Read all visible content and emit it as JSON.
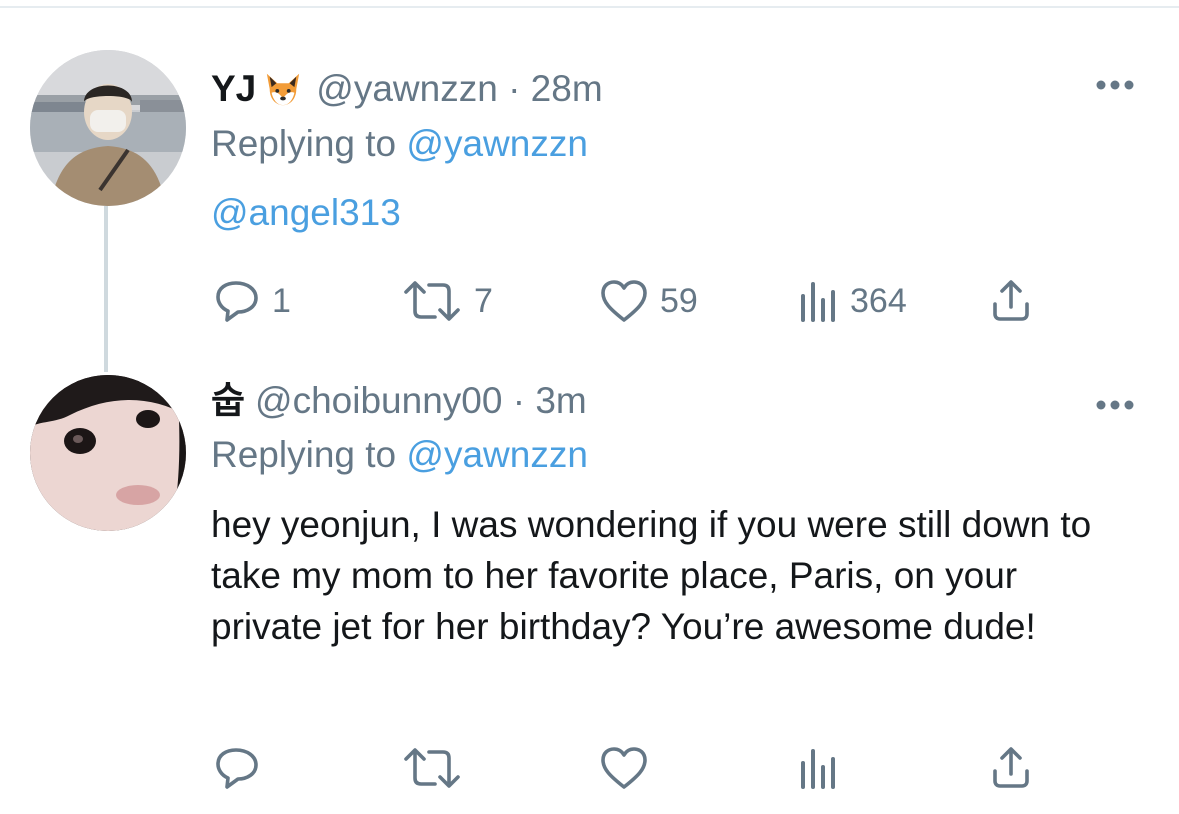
{
  "tweets": [
    {
      "display_name": "YJ",
      "name_emoji": "fox-face-emoji",
      "handle": "@yawnzzn",
      "separator": "·",
      "time": "28m",
      "replying_to_label": "Replying to",
      "replying_to_handle": "@yawnzzn",
      "body": "@angel313",
      "actions": {
        "reply_count": "1",
        "retweet_count": "7",
        "like_count": "59",
        "views_count": "364"
      }
    },
    {
      "display_name": "숩",
      "handle": "@choibunny00",
      "separator": "·",
      "time": "3m",
      "replying_to_label": "Replying to",
      "replying_to_handle": "@yawnzzn",
      "body": "hey yeonjun, I was wondering if you were still down to take my mom to her favorite place, Paris, on your private jet for her birthday? You’re awesome dude!",
      "actions": {
        "reply_count": "",
        "retweet_count": "",
        "like_count": "",
        "views_count": ""
      }
    }
  ],
  "colors": {
    "link": "#4a9fe0",
    "secondary_text": "#657786",
    "thread_line": "#cfd9de"
  }
}
